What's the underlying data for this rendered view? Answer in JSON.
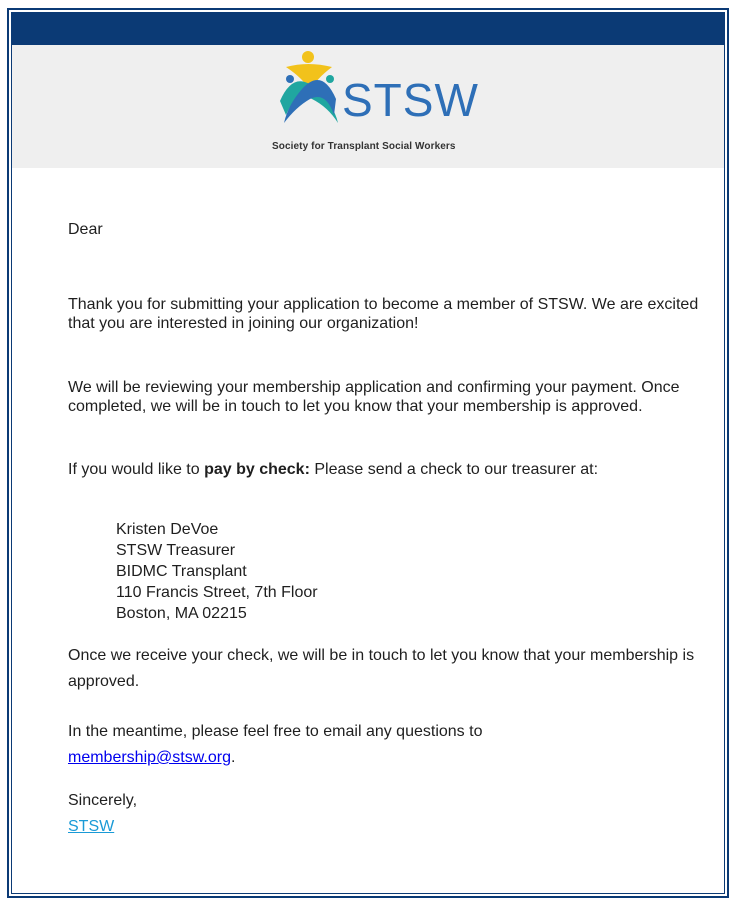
{
  "brand": {
    "name": "STSW",
    "tagline": "Society for Transplant Social Workers",
    "primary_color": "#0b3a75",
    "logo_blue": "#2e6fb7",
    "logo_yellow": "#f2c21b",
    "logo_teal": "#20a6a0"
  },
  "letter": {
    "salutation": "Dear",
    "para1": "Thank you for submitting your application to become a member of STSW.  We are excited that you are interested in joining our organization!",
    "para2": "We will be reviewing your membership application and confirming your payment.  Once completed, we will be in touch to let you know that your membership is approved.",
    "para3_prefix": "If you would like to ",
    "para3_bold": "pay by check:",
    "para3_suffix": "  Please send a check to our treasurer at:",
    "address": [
      "Kristen DeVoe",
      "STSW Treasurer",
      "BIDMC Transplant",
      "110 Francis Street, 7th Floor",
      "Boston, MA 02215"
    ],
    "para4": "Once we receive your check, we will be in touch to let you know that your membership is approved.",
    "para5_prefix": "In the meantime, please feel free to email any questions to",
    "email": "membership@stsw.org",
    "para5_suffix": ".",
    "closing": "Sincerely,",
    "signature": "STSW"
  }
}
